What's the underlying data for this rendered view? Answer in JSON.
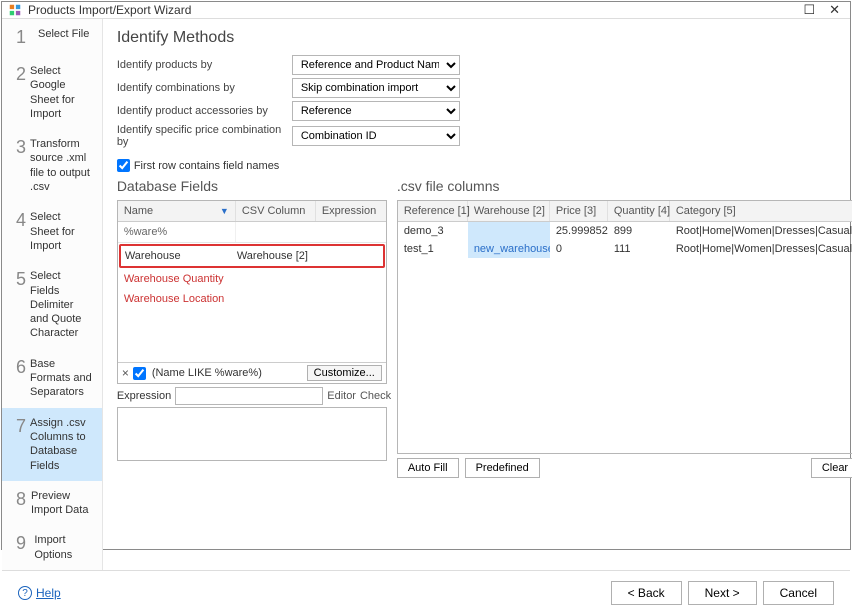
{
  "window": {
    "title": "Products Import/Export Wizard"
  },
  "sidebar": {
    "steps": [
      {
        "num": "1",
        "label": "Select File"
      },
      {
        "num": "2",
        "label": "Select Google Sheet for Import"
      },
      {
        "num": "3",
        "label": "Transform source .xml file to output .csv"
      },
      {
        "num": "4",
        "label": "Select Sheet for Import"
      },
      {
        "num": "5",
        "label": "Select Fields Delimiter and Quote Character"
      },
      {
        "num": "6",
        "label": "Base Formats and Separators"
      },
      {
        "num": "7",
        "label": "Assign .csv Columns to Database Fields"
      },
      {
        "num": "8",
        "label": "Preview Import Data"
      },
      {
        "num": "9",
        "label": "Import Options"
      }
    ],
    "active_index": 6
  },
  "headings": {
    "identify": "Identify Methods",
    "db": "Database Fields",
    "csv": ".csv file columns"
  },
  "identify": {
    "products_label": "Identify products by",
    "products_value": "Reference and Product Name (recommended)",
    "combinations_label": "Identify combinations by",
    "combinations_value": "Skip combination import",
    "accessories_label": "Identify product accessories by",
    "accessories_value": "Reference",
    "pricecomb_label": "Identify specific price combination by",
    "pricecomb_value": "Combination ID",
    "firstrow_label": "First row contains field names"
  },
  "db": {
    "head": {
      "name": "Name",
      "csv": "CSV Column",
      "expr": "Expression"
    },
    "filter": {
      "name": "%ware%"
    },
    "rows": [
      {
        "name": "Warehouse",
        "csv": "Warehouse [2]",
        "highlight": true
      },
      {
        "name": "Warehouse Quantity",
        "red": true
      },
      {
        "name": "Warehouse Location",
        "red": true
      }
    ],
    "filter_text": "(Name LIKE %ware%)",
    "customize_btn": "Customize...",
    "expression_label": "Expression",
    "editor_link": "Editor",
    "check_link": "Check"
  },
  "csv": {
    "head": [
      "Reference [1]",
      "Warehouse [2]",
      "Price [3]",
      "Quantity [4]",
      "Category [5]"
    ],
    "rows": [
      {
        "ref": "demo_3",
        "wh": "",
        "price": "25.999852",
        "qty": "899",
        "cat": "Root|Home|Women|Dresses|Casual"
      },
      {
        "ref": "test_1",
        "wh": "new_warehouse",
        "price": "0",
        "qty": "111",
        "cat": "Root|Home|Women|Dresses|Casual"
      }
    ],
    "buttons": {
      "autofill": "Auto Fill",
      "predefined": "Predefined",
      "clear": "Clear"
    }
  },
  "bottom": {
    "help": "Help",
    "back": "< Back",
    "next": "Next >",
    "cancel": "Cancel"
  }
}
